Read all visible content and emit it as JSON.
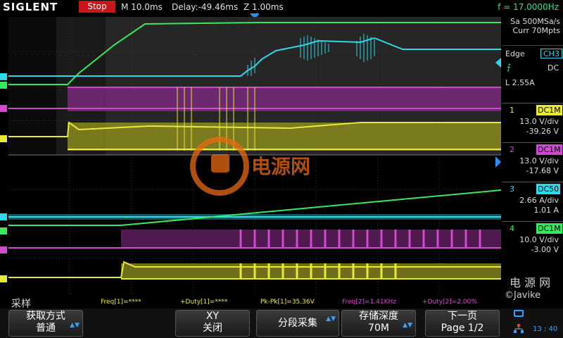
{
  "top": {
    "brand": "SIGLENT",
    "state": "Stop",
    "timebase": "M 10.0ms",
    "delay": "Delay:-49.46ms",
    "zoom": "Z 1.00ms",
    "frequency": "f = 17.0000Hz"
  },
  "acq": {
    "rate": "Sa 500MSa/s",
    "depth": "Curr 70Mpts"
  },
  "trigger": {
    "type": "Edge",
    "source": "CH3",
    "coupling": "DC",
    "level": "L  2.55A"
  },
  "channels": [
    {
      "num": "1",
      "coupling": "DC1M",
      "scale": "13.0 V/div",
      "offset": "-39.26 V",
      "color": "#e8e83a"
    },
    {
      "num": "2",
      "coupling": "DC1M",
      "scale": "13.0 V/div",
      "offset": "-17.68 V",
      "color": "#d04ad0"
    },
    {
      "num": "3",
      "coupling": "DC50",
      "scale": "2.66 A/div",
      "offset": "1.01 A",
      "color": "#2ed8e8"
    },
    {
      "num": "4",
      "coupling": "DC1M",
      "scale": "10.0 V/div",
      "offset": "-3.00 V",
      "color": "#3ae860"
    }
  ],
  "measurements": {
    "mode": "采样",
    "items": [
      "Freq[1]=****",
      "+Duty[1]=****",
      "Pk-Pk[1]=35.36V",
      "Freq[2]=1.41KHz",
      "+Duty[2]=2.00%"
    ]
  },
  "softkeys": [
    {
      "line1": "获取方式",
      "line2": "普通",
      "arrow": true
    },
    {
      "line1": "XY",
      "line2": "关闭",
      "arrow": false
    },
    {
      "line1": "分段采集",
      "line2": "",
      "arrow": true
    },
    {
      "line1": "存储深度",
      "line2": "70M",
      "arrow": true
    },
    {
      "line1": "下一页",
      "line2": "Page 1/2",
      "arrow": false
    }
  ],
  "watermark": {
    "logo_text": "电源网",
    "cn": "电 源 网",
    "en": "©Javike"
  },
  "clock": "13 : 40",
  "colors": {
    "ch1": "#e8e83a",
    "ch2": "#d04ad0",
    "ch3": "#2ed8e8",
    "ch4": "#3ae860",
    "stop": "#c8161b",
    "accent": "#2a8ff0"
  }
}
